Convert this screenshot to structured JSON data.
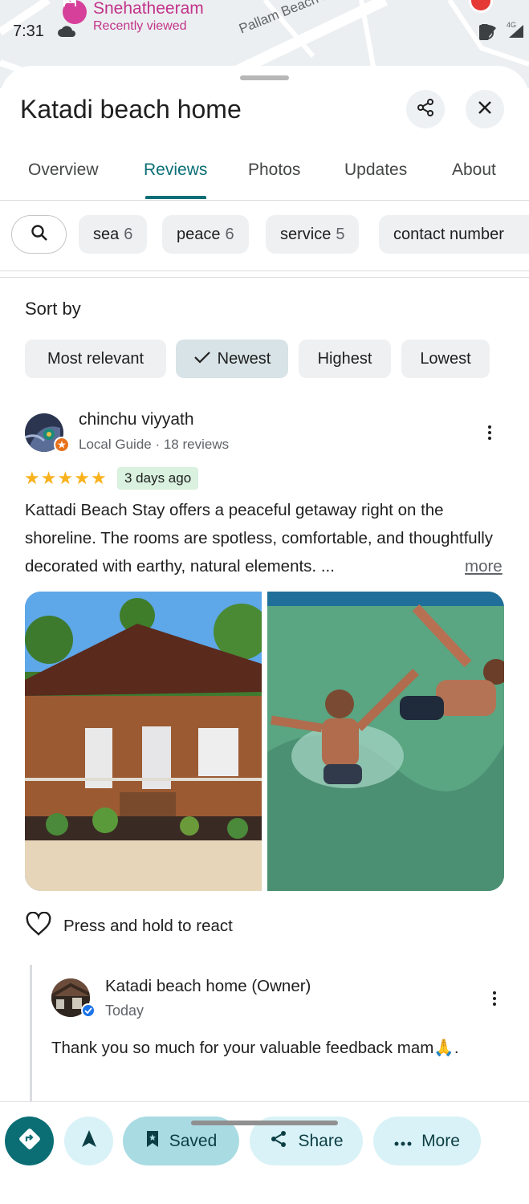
{
  "status": {
    "time": "7:31",
    "network": "4G"
  },
  "map": {
    "poi_name": "Snehatheeram",
    "poi_sub": "Recently viewed",
    "road_label": "Pallam Beach Rd"
  },
  "place": {
    "title": "Katadi beach home"
  },
  "tabs": [
    {
      "label": "Overview"
    },
    {
      "label": "Reviews"
    },
    {
      "label": "Photos"
    },
    {
      "label": "Updates"
    },
    {
      "label": "About"
    }
  ],
  "active_tab": "Reviews",
  "topic_chips": [
    {
      "label": "sea",
      "count": "6"
    },
    {
      "label": "peace",
      "count": "6"
    },
    {
      "label": "service",
      "count": "5"
    },
    {
      "label": "contact number",
      "count": ""
    }
  ],
  "sort": {
    "label": "Sort by",
    "options": [
      "Most relevant",
      "Newest",
      "Highest",
      "Lowest"
    ],
    "selected": "Newest"
  },
  "review": {
    "author": "chinchu viyyath",
    "meta": "Local Guide · 18 reviews",
    "rating": 5,
    "date": "3 days ago",
    "text": "Kattadi Beach Stay offers a peaceful getaway right on the shoreline. The rooms are spotless, comfortable, and thoughtfully decorated with earthy, natural elements. ...",
    "more": "more",
    "react_label": "Press and hold to react"
  },
  "owner_reply": {
    "name": "Katadi beach home (Owner)",
    "date": "Today",
    "text": "Thank you so much for your valuable feedback mam🙏."
  },
  "actions": {
    "saved": "Saved",
    "share": "Share",
    "more": "More"
  },
  "colors": {
    "accent": "#0b6e75",
    "chip_bg": "#eef0f1",
    "action_bg": "#d9f2f7",
    "star": "#f9b21d",
    "date_badge": "#d9f1de",
    "poi": "#c2338a"
  }
}
